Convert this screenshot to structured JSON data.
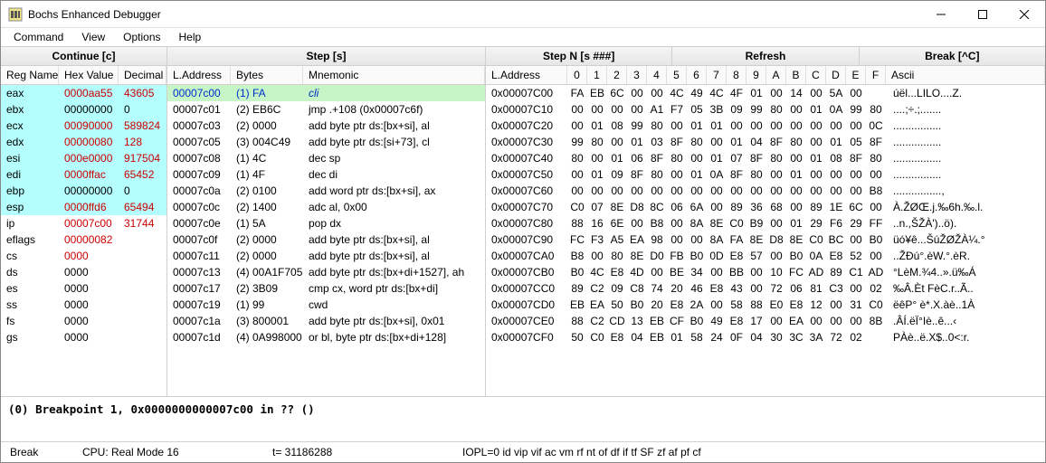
{
  "window": {
    "title": "Bochs Enhanced Debugger"
  },
  "menu": [
    "Command",
    "View",
    "Options",
    "Help"
  ],
  "toolbar": {
    "continue": "Continue [c]",
    "step": "Step [s]",
    "stepn": "Step N [s ###]",
    "refresh": "Refresh",
    "break": "Break [^C]"
  },
  "registers": {
    "headers": {
      "name": "Reg Name",
      "hex": "Hex Value",
      "dec": "Decimal"
    },
    "rows": [
      {
        "name": "eax",
        "hex": "0000aa55",
        "dec": "43605",
        "hi": true,
        "red": true
      },
      {
        "name": "ebx",
        "hex": "00000000",
        "dec": "0",
        "hi": true,
        "red": false
      },
      {
        "name": "ecx",
        "hex": "00090000",
        "dec": "589824",
        "hi": true,
        "red": true
      },
      {
        "name": "edx",
        "hex": "00000080",
        "dec": "128",
        "hi": true,
        "red": true
      },
      {
        "name": "esi",
        "hex": "000e0000",
        "dec": "917504",
        "hi": true,
        "red": true
      },
      {
        "name": "edi",
        "hex": "0000ffac",
        "dec": "65452",
        "hi": true,
        "red": true
      },
      {
        "name": "ebp",
        "hex": "00000000",
        "dec": "0",
        "hi": true,
        "red": false
      },
      {
        "name": "esp",
        "hex": "0000ffd6",
        "dec": "65494",
        "hi": true,
        "red": true
      },
      {
        "name": "ip",
        "hex": "00007c00",
        "dec": "31744",
        "hi": false,
        "red": true
      },
      {
        "name": "eflags",
        "hex": "00000082",
        "dec": "",
        "hi": false,
        "red": true
      },
      {
        "name": "cs",
        "hex": "0000",
        "dec": "",
        "hi": false,
        "red": true
      },
      {
        "name": "ds",
        "hex": "0000",
        "dec": "",
        "hi": false,
        "red": false
      },
      {
        "name": "es",
        "hex": "0000",
        "dec": "",
        "hi": false,
        "red": false
      },
      {
        "name": "ss",
        "hex": "0000",
        "dec": "",
        "hi": false,
        "red": false
      },
      {
        "name": "fs",
        "hex": "0000",
        "dec": "",
        "hi": false,
        "red": false
      },
      {
        "name": "gs",
        "hex": "0000",
        "dec": "",
        "hi": false,
        "red": false
      }
    ]
  },
  "disasm": {
    "headers": {
      "addr": "L.Address",
      "bytes": "Bytes",
      "mnem": "Mnemonic"
    },
    "rows": [
      {
        "addr": "00007c00",
        "bytes": "(1) FA",
        "mnem": "cli",
        "cur": true
      },
      {
        "addr": "00007c01",
        "bytes": "(2) EB6C",
        "mnem": "jmp .+108 (0x00007c6f)"
      },
      {
        "addr": "00007c03",
        "bytes": "(2) 0000",
        "mnem": "add byte ptr ds:[bx+si], al"
      },
      {
        "addr": "00007c05",
        "bytes": "(3) 004C49",
        "mnem": "add byte ptr ds:[si+73], cl"
      },
      {
        "addr": "00007c08",
        "bytes": "(1) 4C",
        "mnem": "dec sp"
      },
      {
        "addr": "00007c09",
        "bytes": "(1) 4F",
        "mnem": "dec di"
      },
      {
        "addr": "00007c0a",
        "bytes": "(2) 0100",
        "mnem": "add word ptr ds:[bx+si], ax"
      },
      {
        "addr": "00007c0c",
        "bytes": "(2) 1400",
        "mnem": "adc al, 0x00"
      },
      {
        "addr": "00007c0e",
        "bytes": "(1) 5A",
        "mnem": "pop dx"
      },
      {
        "addr": "00007c0f",
        "bytes": "(2) 0000",
        "mnem": "add byte ptr ds:[bx+si], al"
      },
      {
        "addr": "00007c11",
        "bytes": "(2) 0000",
        "mnem": "add byte ptr ds:[bx+si], al"
      },
      {
        "addr": "00007c13",
        "bytes": "(4) 00A1F705",
        "mnem": "add byte ptr ds:[bx+di+1527], ah"
      },
      {
        "addr": "00007c17",
        "bytes": "(2) 3B09",
        "mnem": "cmp cx, word ptr ds:[bx+di]"
      },
      {
        "addr": "00007c19",
        "bytes": "(1) 99",
        "mnem": "cwd"
      },
      {
        "addr": "00007c1a",
        "bytes": "(3) 800001",
        "mnem": "add byte ptr ds:[bx+si], 0x01"
      },
      {
        "addr": "00007c1d",
        "bytes": "(4) 0A998000",
        "mnem": "or bl, byte ptr ds:[bx+di+128]"
      }
    ]
  },
  "memory": {
    "header_addr": "L.Address",
    "header_hex": [
      "0",
      "1",
      "2",
      "3",
      "4",
      "5",
      "6",
      "7",
      "8",
      "9",
      "A",
      "B",
      "C",
      "D",
      "E",
      "F"
    ],
    "header_ascii": "Ascii",
    "rows": [
      {
        "addr": "0x00007C00",
        "b": [
          "FA",
          "EB",
          "6C",
          "00",
          "00",
          "4C",
          "49",
          "4C",
          "4F",
          "01",
          "00",
          "14",
          "00",
          "5A",
          "00"
        ],
        "ascii": "úël...LILO....Z."
      },
      {
        "addr": "0x00007C10",
        "b": [
          "00",
          "00",
          "00",
          "00",
          "A1",
          "F7",
          "05",
          "3B",
          "09",
          "99",
          "80",
          "00",
          "01",
          "0A",
          "99",
          "80"
        ],
        "ascii": "....;÷.;......."
      },
      {
        "addr": "0x00007C20",
        "b": [
          "00",
          "01",
          "08",
          "99",
          "80",
          "00",
          "01",
          "01",
          "00",
          "00",
          "00",
          "00",
          "00",
          "00",
          "00",
          "0C"
        ],
        "ascii": "................"
      },
      {
        "addr": "0x00007C30",
        "b": [
          "99",
          "80",
          "00",
          "01",
          "03",
          "8F",
          "80",
          "00",
          "01",
          "04",
          "8F",
          "80",
          "00",
          "01",
          "05",
          "8F"
        ],
        "ascii": "................"
      },
      {
        "addr": "0x00007C40",
        "b": [
          "80",
          "00",
          "01",
          "06",
          "8F",
          "80",
          "00",
          "01",
          "07",
          "8F",
          "80",
          "00",
          "01",
          "08",
          "8F",
          "80"
        ],
        "ascii": "................"
      },
      {
        "addr": "0x00007C50",
        "b": [
          "00",
          "01",
          "09",
          "8F",
          "80",
          "00",
          "01",
          "0A",
          "8F",
          "80",
          "00",
          "01",
          "00",
          "00",
          "00",
          "00"
        ],
        "ascii": "................"
      },
      {
        "addr": "0x00007C60",
        "b": [
          "00",
          "00",
          "00",
          "00",
          "00",
          "00",
          "00",
          "00",
          "00",
          "00",
          "00",
          "00",
          "00",
          "00",
          "00",
          "B8"
        ],
        "ascii": "................,"
      },
      {
        "addr": "0x00007C70",
        "b": [
          "C0",
          "07",
          "8E",
          "D8",
          "8C",
          "06",
          "6A",
          "00",
          "89",
          "36",
          "68",
          "00",
          "89",
          "1E",
          "6C",
          "00"
        ],
        "ascii": "À.ŽØŒ.j.‰6h.‰.l."
      },
      {
        "addr": "0x00007C80",
        "b": [
          "88",
          "16",
          "6E",
          "00",
          "B8",
          "00",
          "8A",
          "8E",
          "C0",
          "B9",
          "00",
          "01",
          "29",
          "F6",
          "29",
          "FF"
        ],
        "ascii": "..n.,ŠŽÀ')..ö)."
      },
      {
        "addr": "0x00007C90",
        "b": [
          "FC",
          "F3",
          "A5",
          "EA",
          "98",
          "00",
          "00",
          "8A",
          "FA",
          "8E",
          "D8",
          "8E",
          "C0",
          "BC",
          "00",
          "B0"
        ],
        "ascii": "üó¥ê...ŠúŽØŽÀ¼.°"
      },
      {
        "addr": "0x00007CA0",
        "b": [
          "B8",
          "00",
          "80",
          "8E",
          "D0",
          "FB",
          "B0",
          "0D",
          "E8",
          "57",
          "00",
          "B0",
          "0A",
          "E8",
          "52",
          "00"
        ],
        "ascii": "..ŽĐú°.èW.°.èR."
      },
      {
        "addr": "0x00007CB0",
        "b": [
          "B0",
          "4C",
          "E8",
          "4D",
          "00",
          "BE",
          "34",
          "00",
          "BB",
          "00",
          "10",
          "FC",
          "AD",
          "89",
          "C1",
          "AD"
        ],
        "ascii": "°LèM.¾4..».ü­‰Á­"
      },
      {
        "addr": "0x00007CC0",
        "b": [
          "89",
          "C2",
          "09",
          "C8",
          "74",
          "20",
          "46",
          "E8",
          "43",
          "00",
          "72",
          "06",
          "81",
          "C3",
          "00",
          "02"
        ],
        "ascii": "‰Â.Èt FèC.r..Ã.."
      },
      {
        "addr": "0x00007CD0",
        "b": [
          "EB",
          "EA",
          "50",
          "B0",
          "20",
          "E8",
          "2A",
          "00",
          "58",
          "88",
          "E0",
          "E8",
          "12",
          "00",
          "31",
          "C0"
        ],
        "ascii": "ëêP° è*.X.àè..1À"
      },
      {
        "addr": "0x00007CE0",
        "b": [
          "88",
          "C2",
          "CD",
          "13",
          "EB",
          "CF",
          "B0",
          "49",
          "E8",
          "17",
          "00",
          "EA",
          "00",
          "00",
          "00",
          "8B"
        ],
        "ascii": ".ÂÍ.ëÏ°Iè..ê...‹"
      },
      {
        "addr": "0x00007CF0",
        "b": [
          "50",
          "C0",
          "E8",
          "04",
          "EB",
          "01",
          "58",
          "24",
          "0F",
          "04",
          "30",
          "3C",
          "3A",
          "72",
          "02"
        ],
        "ascii": "PÀè..ë.X$..0<:r."
      }
    ]
  },
  "console": "(0) Breakpoint 1, 0x0000000000007c00 in ?? ()",
  "status": {
    "state": "Break",
    "cpu": "CPU: Real Mode 16",
    "t": "t= 31186288",
    "flags": "IOPL=0 id vip vif ac vm rf nt of df if tf SF zf af pf cf"
  }
}
